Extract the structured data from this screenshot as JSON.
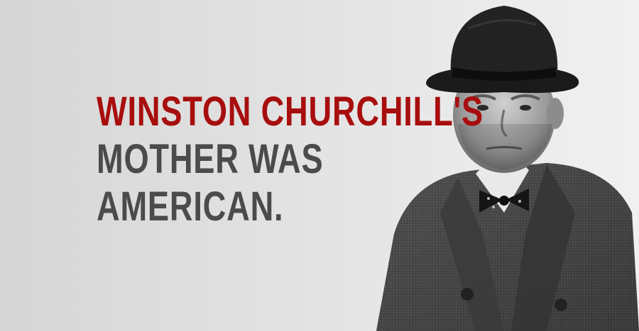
{
  "quote": {
    "line1": "WINSTON CHURCHILL'S",
    "line2": "MOTHER WAS",
    "line3": "AMERICAN."
  },
  "colors": {
    "accent": "#a80e0e",
    "body": "#4b4b4b",
    "background": "#e0e0e0"
  },
  "image": {
    "subject_icon": "portrait-photo-man-in-bowler-hat"
  }
}
